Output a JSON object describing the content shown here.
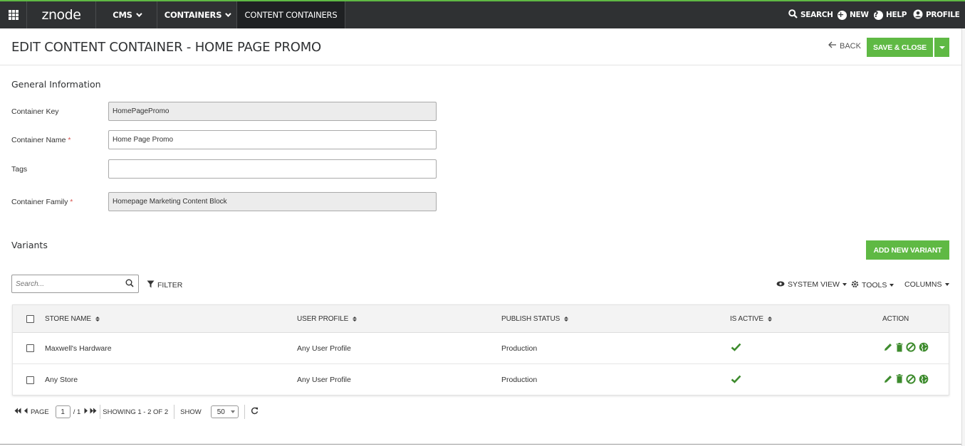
{
  "topnav": {
    "logo": "znode",
    "items": [
      {
        "label": "CMS"
      },
      {
        "label": "CONTAINERS"
      },
      {
        "label": "CONTENT CONTAINERS"
      }
    ],
    "search_label": "SEARCH",
    "new_label": "NEW",
    "help_label": "HELP",
    "profile_label": "PROFILE"
  },
  "header": {
    "title": "EDIT CONTENT CONTAINER - HOME PAGE PROMO",
    "back_label": "BACK",
    "save_label": "SAVE & CLOSE"
  },
  "general": {
    "title": "General Information",
    "fields": [
      {
        "label": "Container Key",
        "value": "HomePageProm​o",
        "required": false
      },
      {
        "label": "Container Name",
        "value": "Home Page Promo",
        "required": true
      },
      {
        "label": "Tags",
        "value": "",
        "required": false
      },
      {
        "label": "Container Family",
        "value": "Homepage Marketing Content Block",
        "required": true
      }
    ],
    "required_marker": "*"
  },
  "variants": {
    "title": "Variants",
    "add_label": "ADD NEW VARIANT",
    "search_placeholder": "Search...",
    "filter_label": "FILTER",
    "system_view_label": "SYSTEM VIEW",
    "tools_label": "TOOLS",
    "columns_label": "COLUMNS",
    "columns": [
      "STORE NAME",
      "USER PROFILE",
      "PUBLISH STATUS",
      "IS ACTIVE",
      "ACTION"
    ],
    "rows": [
      {
        "store": "Maxwell's Hardware",
        "profile": "Any User Profile",
        "status": "Production",
        "active": true
      },
      {
        "store": "Any Store",
        "profile": "Any User Profile",
        "status": "Production",
        "active": true
      }
    ]
  },
  "pager": {
    "page_label": "PAGE",
    "page": "1",
    "total": "/ 1",
    "showing": "SHOWING 1 - 2 OF 2",
    "show_label": "SHOW",
    "page_size": "50"
  },
  "colors": {
    "accent": "#5fb944",
    "topbar": "#2f3133"
  }
}
